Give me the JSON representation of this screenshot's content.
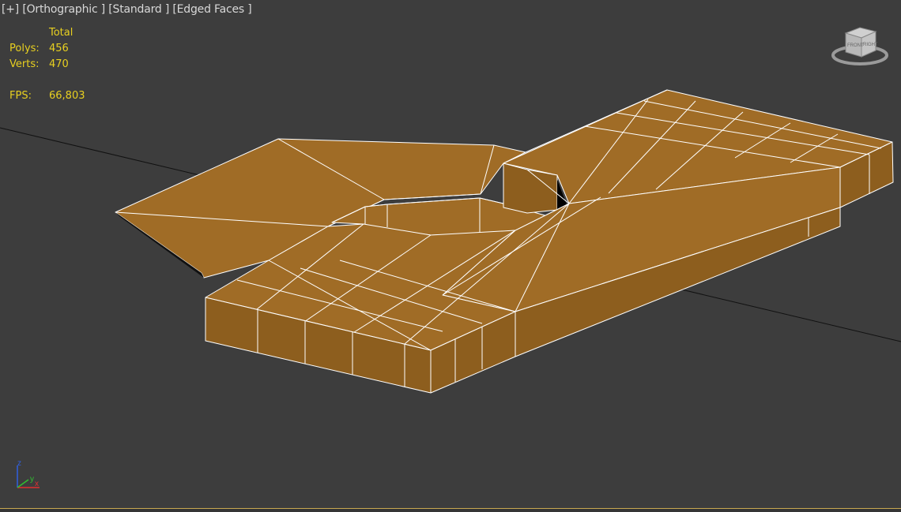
{
  "viewport": {
    "label_plus": "[+]",
    "label_view": "[Orthographic ]",
    "label_shading": "[Standard ]",
    "label_faces": "[Edged Faces ]"
  },
  "stats": {
    "header": "Total",
    "polys_label": "Polys:",
    "polys_value": "456",
    "verts_label": "Verts:",
    "verts_value": "470",
    "fps_label": "FPS:",
    "fps_value": "66,803"
  },
  "viewcube": {
    "front_label": "FRONT",
    "right_label": "RIGHT"
  },
  "axis_tripod": {
    "x": "x",
    "y": "y",
    "z": "z"
  },
  "colors": {
    "background": "#3d3d3d",
    "mesh_face": "#a06c26",
    "mesh_face_side": "#8d5e1e",
    "mesh_edge": "#ffffff",
    "stats_text": "#e8d020",
    "label_text": "#d8d8d8",
    "axis_x": "#e03030",
    "axis_y": "#30c030",
    "axis_z": "#3060e0"
  }
}
